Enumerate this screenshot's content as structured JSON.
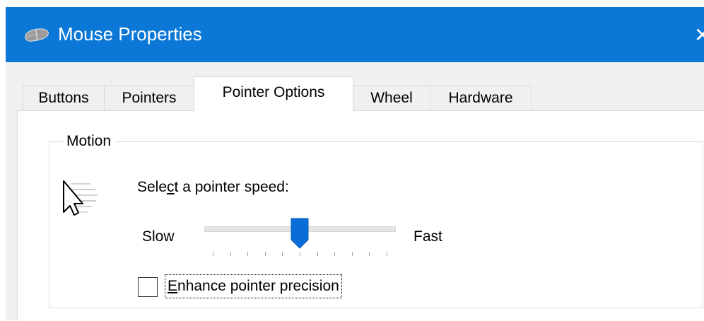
{
  "window": {
    "title": "Mouse Properties",
    "close_glyph": "✕",
    "accent_color": "#0b78d7",
    "icon": "mouse-icon"
  },
  "tabs": [
    {
      "label": "Buttons",
      "active": false
    },
    {
      "label": "Pointers",
      "active": false
    },
    {
      "label": "Pointer Options",
      "active": true
    },
    {
      "label": "Wheel",
      "active": false
    },
    {
      "label": "Hardware",
      "active": false
    }
  ],
  "motion": {
    "group_label": "Motion",
    "icon": "pointer-speed-icon",
    "speed_label_pre": "Sele",
    "speed_label_access": "c",
    "speed_label_post": "t a pointer speed:",
    "slow_label": "Slow",
    "fast_label": "Fast",
    "slider": {
      "min": 1,
      "max": 11,
      "value": 6
    },
    "enhance_precision": {
      "checked": false,
      "label_access": "E",
      "label_rest": "nhance pointer precision"
    }
  }
}
